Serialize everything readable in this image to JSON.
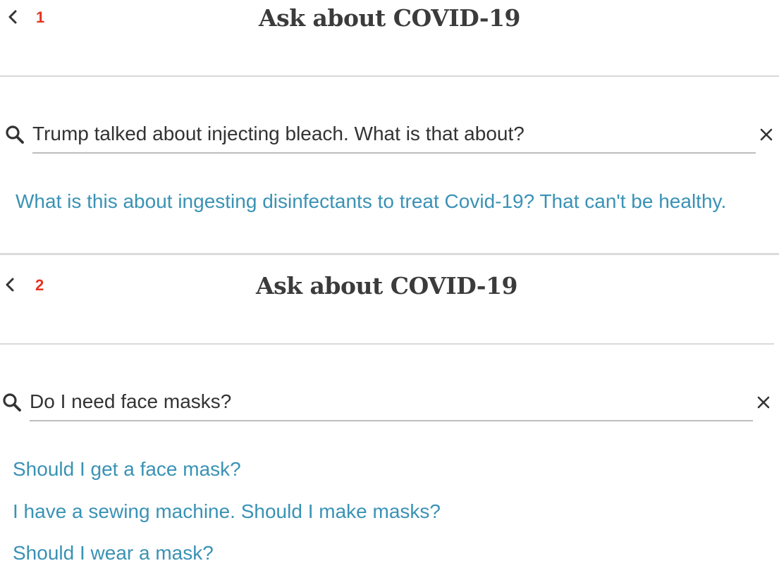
{
  "panels": [
    {
      "step": "1",
      "title": "Ask about COVID-19",
      "search": {
        "value": "Trump talked about injecting bleach. What is that about?",
        "icon": "search-icon",
        "clear_icon": "close-icon"
      },
      "suggestions": [
        "What is this about ingesting disinfectants to treat Covid-19? That can't be healthy."
      ]
    },
    {
      "step": "2",
      "title": "Ask about COVID-19",
      "search": {
        "value": "Do I need face masks?",
        "icon": "search-icon",
        "clear_icon": "close-icon"
      },
      "suggestions": [
        "Should I get a face mask?",
        "I have a sewing machine. Should I make masks?",
        "Should I wear a mask?"
      ]
    }
  ],
  "colors": {
    "step_number": "#e8321f",
    "suggestion_link": "#3a92b5",
    "title": "#3b3b3b",
    "rule": "#d9d9d9"
  }
}
